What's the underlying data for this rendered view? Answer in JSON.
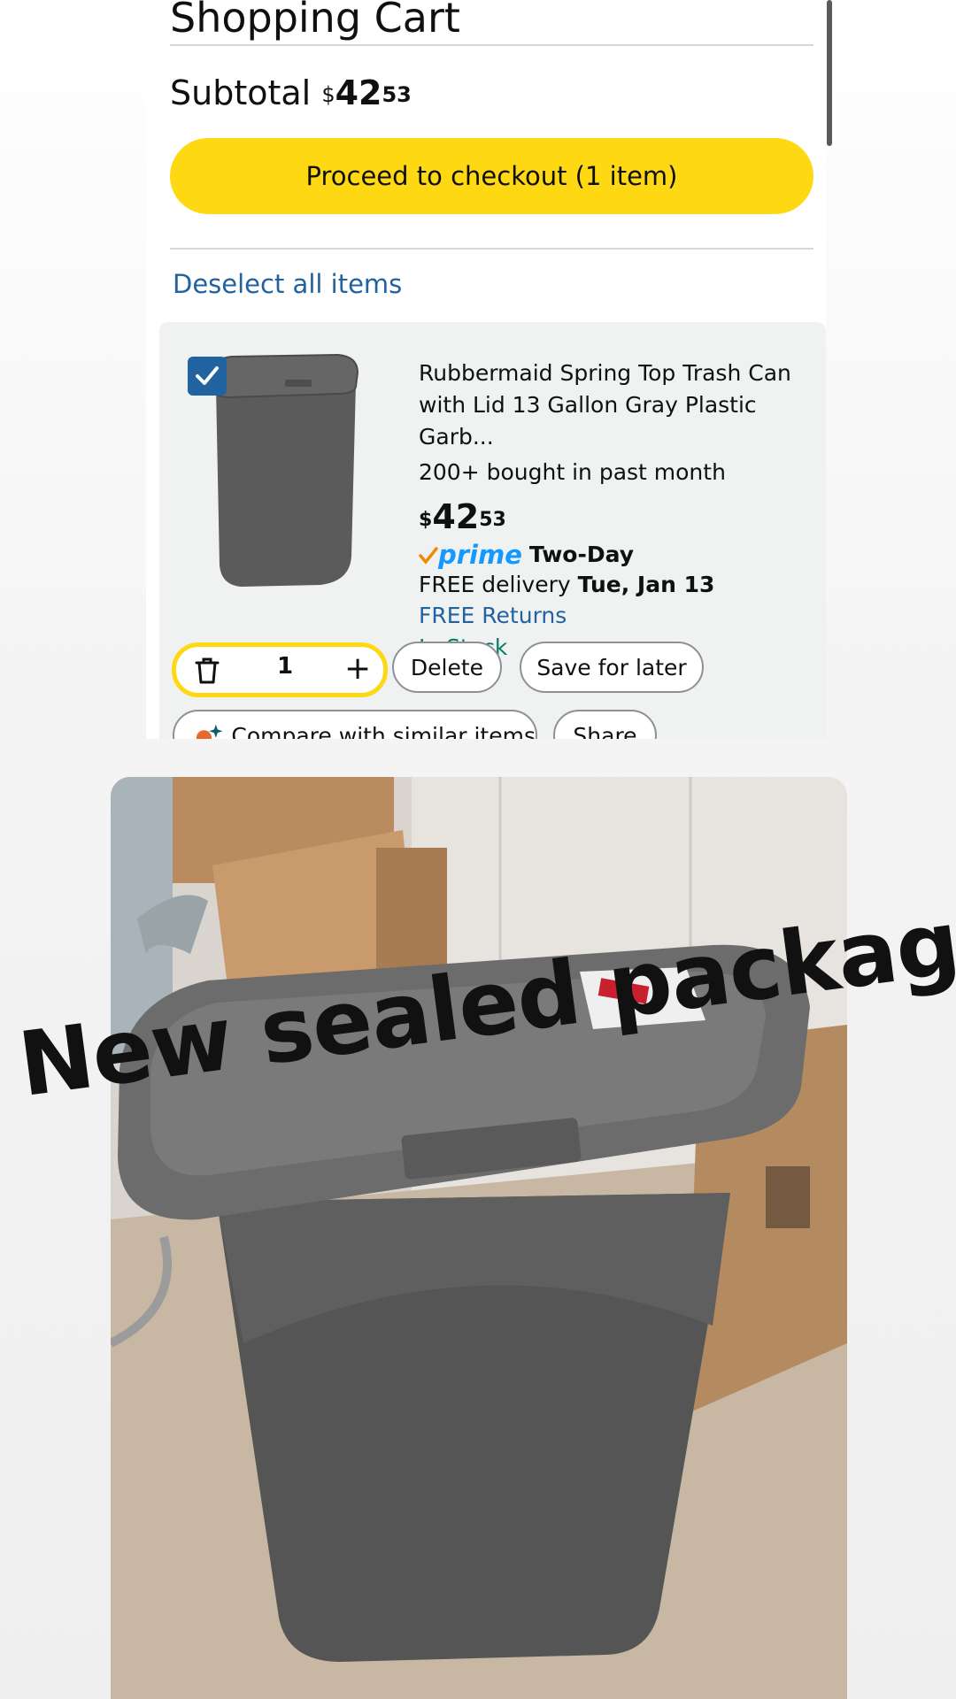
{
  "header": {
    "title": "Shopping Cart"
  },
  "subtotal": {
    "label": "Subtotal",
    "currency": "$",
    "dollars": "42",
    "cents": "53"
  },
  "checkout": {
    "label": "Proceed to checkout (1 item)"
  },
  "deselect": {
    "label": "Deselect all items"
  },
  "item": {
    "selected": true,
    "title_line1": "Rubbermaid Spring Top Trash Can",
    "title_line2": "with Lid 13 Gallon Gray Plastic Garb...",
    "bought": "200+ bought in past month",
    "price": {
      "currency": "$",
      "dollars": "42",
      "cents": "53"
    },
    "prime": {
      "word": "prime",
      "tier": "Two-Day"
    },
    "delivery": {
      "prefix": "FREE delivery",
      "date": "Tue, Jan 13"
    },
    "returns": "FREE Returns",
    "stock": "In Stock",
    "quantity": "1"
  },
  "actions": {
    "delete": "Delete",
    "save_for_later": "Save for later",
    "compare": "Compare with similar items",
    "share": "Share"
  },
  "photo": {
    "caption": "New sealed packages"
  },
  "colors": {
    "accent_yellow": "#ffd814",
    "link_blue": "#2162a1",
    "stock_green": "#067d62",
    "prime_blue": "#1399ff"
  }
}
